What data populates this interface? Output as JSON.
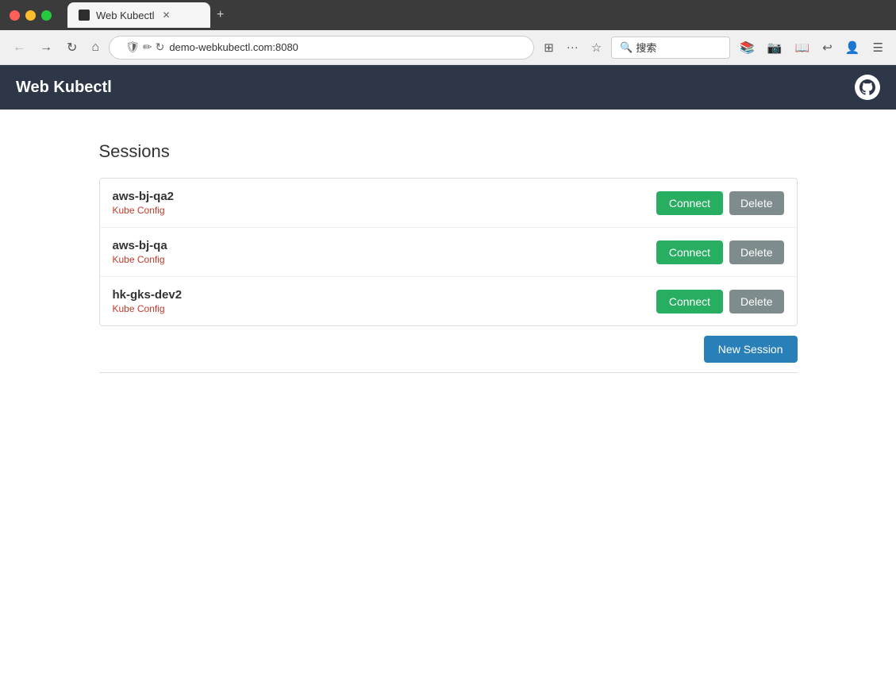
{
  "browser": {
    "tab_title": "Web Kubectl",
    "url": "demo-webkubectl.com:8080",
    "search_placeholder": "搜索",
    "new_tab_label": "+"
  },
  "app": {
    "title": "Web Kubectl",
    "github_icon": "🐙"
  },
  "sessions": {
    "heading": "Sessions",
    "items": [
      {
        "name": "aws-bj-qa2",
        "type": "Kube Config",
        "connect_label": "Connect",
        "delete_label": "Delete"
      },
      {
        "name": "aws-bj-qa",
        "type": "Kube Config",
        "connect_label": "Connect",
        "delete_label": "Delete"
      },
      {
        "name": "hk-gks-dev2",
        "type": "Kube Config",
        "connect_label": "Connect",
        "delete_label": "Delete"
      }
    ],
    "new_session_label": "New Session"
  }
}
